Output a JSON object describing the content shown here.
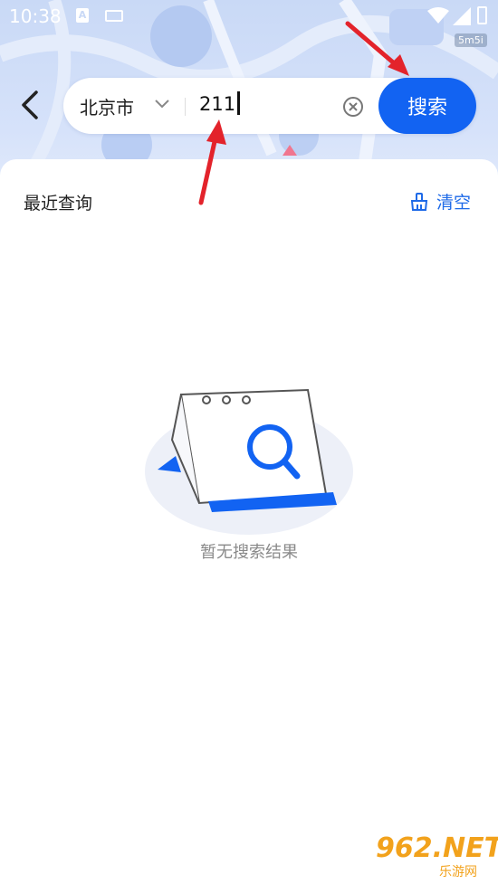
{
  "status_bar": {
    "time": "10:38",
    "notification_badge": "5m5i"
  },
  "search": {
    "city": "北京市",
    "query": "211",
    "button_label": "搜索"
  },
  "recent": {
    "title": "最近查询",
    "clear_label": "清空"
  },
  "empty_state": {
    "message": "暂无搜索结果"
  },
  "watermark": {
    "main": "962.NET",
    "sub": "乐游网"
  },
  "colors": {
    "accent": "#1263f2",
    "link": "#1e6ae8",
    "annotation_arrow": "#e3232b"
  }
}
